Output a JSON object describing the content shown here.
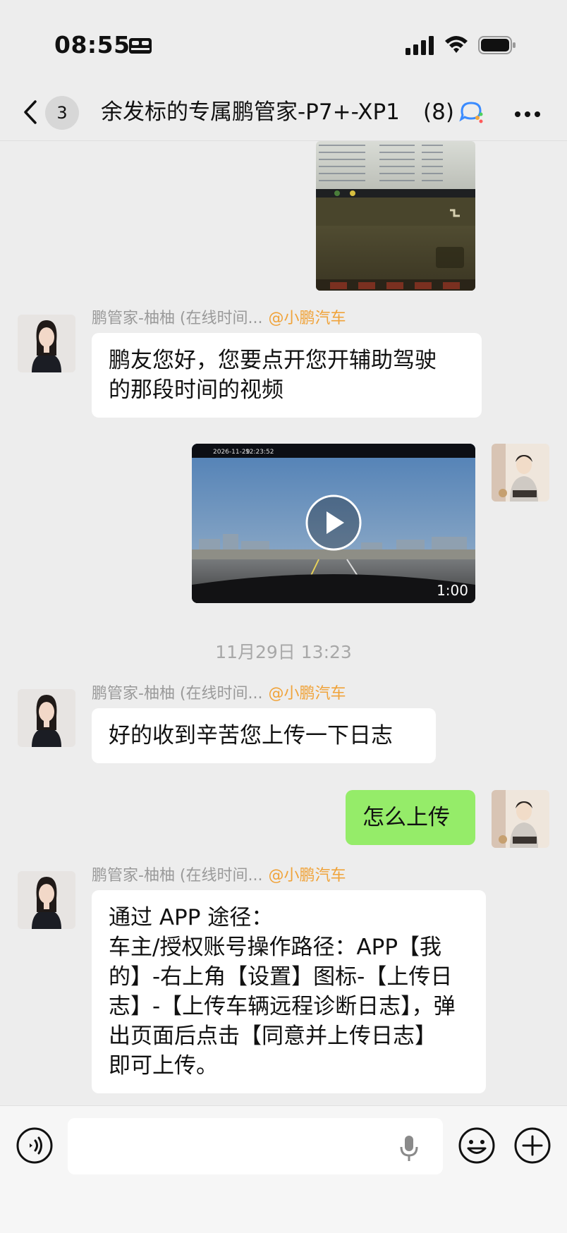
{
  "status_bar": {
    "time": "08:55"
  },
  "header": {
    "unread_count": "3",
    "title": "余发标的专属鹏管家-P7+-XP1",
    "member_count": "(8)"
  },
  "messages": [
    {
      "type": "image",
      "direction": "in-self"
    },
    {
      "direction": "in",
      "sender": "鹏管家-柚柚 (在线时间...",
      "sender_tag": "@小鹏汽车",
      "text_lines": [
        "鹏友您好，您要点开您开辅助驾驶",
        "的那段时间的视频"
      ]
    },
    {
      "type": "video",
      "direction": "out",
      "duration": "1:00",
      "video_overlay_date": "2026-11-29",
      "video_overlay_time": "12:23:52"
    },
    {
      "type": "timestamp",
      "text": "11月29日 13:23"
    },
    {
      "direction": "in",
      "sender": "鹏管家-柚柚 (在线时间...",
      "sender_tag": "@小鹏汽车",
      "text_lines": [
        "好的收到辛苦您上传一下日志"
      ]
    },
    {
      "direction": "out",
      "text_lines": [
        "怎么上传"
      ]
    },
    {
      "direction": "in",
      "sender": "鹏管家-柚柚 (在线时间...",
      "sender_tag": "@小鹏汽车",
      "text_lines": [
        "通过 APP 途径：",
        "车主/授权账号操作路径：APP【我",
        "的】-右上角【设置】图标-【上传日",
        "志】-【上传车辆远程诊断日志】，弹",
        "出页面后点击【同意并上传日志】",
        "即可上传。"
      ]
    }
  ],
  "input": {
    "placeholder": ""
  },
  "colors": {
    "out_bubble": "#95ec69",
    "in_bubble": "#ffffff",
    "sender_tag": "#f0a33a",
    "background": "#ededed"
  }
}
